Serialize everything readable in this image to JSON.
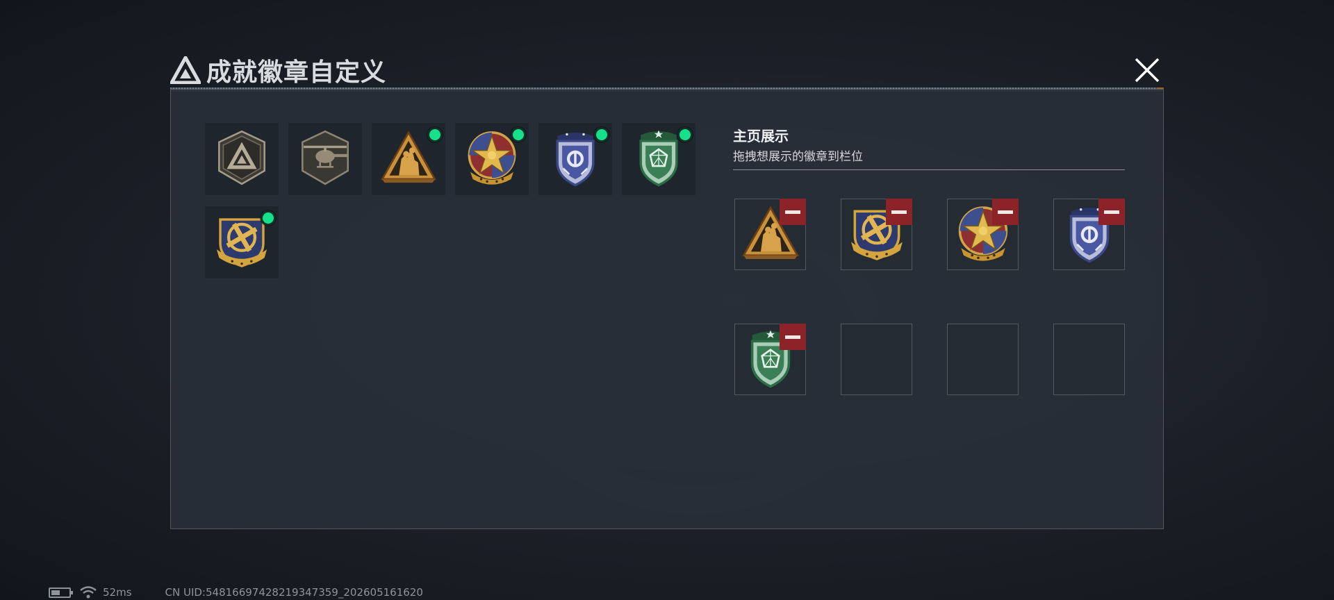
{
  "header": {
    "title": "成就徽章自定义",
    "title_icon": "triangle-logo-icon",
    "close_icon": "close-icon"
  },
  "collection": {
    "badges": [
      {
        "name": "shield-triangle-badge",
        "icon": "shield-triangle-badge-icon",
        "new": false
      },
      {
        "name": "helicopter-badge",
        "icon": "helicopter-badge-icon",
        "new": false
      },
      {
        "name": "soldiers-triangle-badge",
        "icon": "soldiers-triangle-badge-icon",
        "new": true
      },
      {
        "name": "star-compass-badge",
        "icon": "star-compass-badge-icon",
        "new": true
      },
      {
        "name": "blue-shield-badge",
        "icon": "blue-shield-badge-icon",
        "new": true
      },
      {
        "name": "green-shield-badge",
        "icon": "green-shield-badge-icon",
        "new": true
      },
      {
        "name": "gold-anchor-badge",
        "icon": "gold-anchor-badge-icon",
        "new": true
      }
    ]
  },
  "showcase": {
    "title": "主页展示",
    "subtitle": "拖拽想展示的徽章到栏位",
    "slots": [
      {
        "badge": "soldiers-triangle-badge",
        "removable": true
      },
      {
        "badge": "gold-anchor-badge",
        "removable": true
      },
      {
        "badge": "star-compass-badge",
        "removable": true
      },
      {
        "badge": "blue-shield-badge",
        "removable": true
      },
      {
        "badge": "green-shield-badge",
        "removable": true
      },
      {
        "badge": null,
        "removable": false
      },
      {
        "badge": null,
        "removable": false
      },
      {
        "badge": null,
        "removable": false
      }
    ]
  },
  "statusbar": {
    "ping": "52ms",
    "uid": "CN UID:5481669742821934735​9_202605161620"
  },
  "colors": {
    "new_dot": "#16e08a",
    "remove_button": "#8b2328",
    "panel_bg": "#282f38"
  }
}
